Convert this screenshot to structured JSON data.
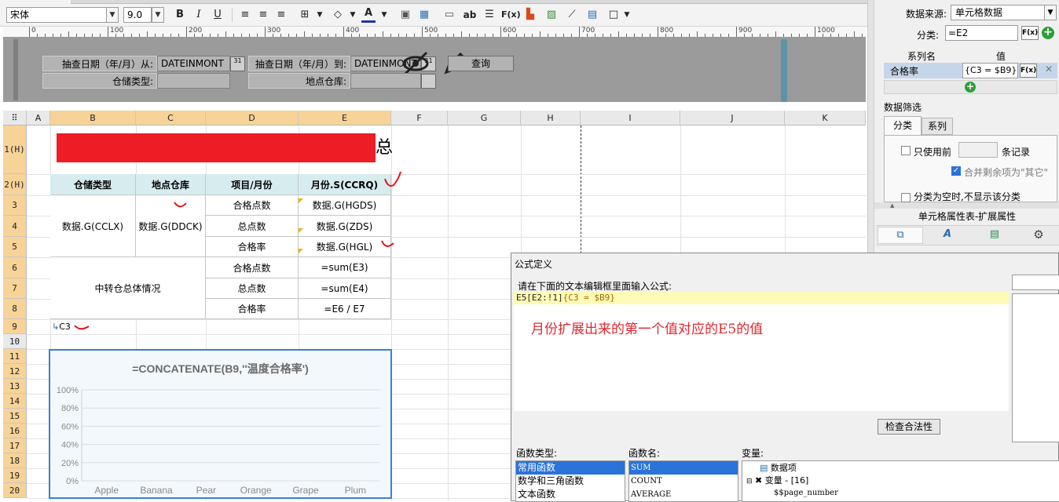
{
  "toolbar": {
    "font_name": "宋体",
    "font_size": "9.0",
    "bold": "B",
    "italic": "I",
    "underline": "U",
    "abc": "ab",
    "formula": "F(x)"
  },
  "ruler": {
    "ticks": [
      "0",
      "100",
      "200",
      "300",
      "400",
      "500",
      "600",
      "700",
      "800",
      "900",
      "1000"
    ]
  },
  "params": {
    "start_label": "抽查日期（年/月）从:",
    "start_value": "DATEINMONT",
    "end_label": "抽查日期（年/月）到:",
    "end_value": "DATEINMONT",
    "query_button": "查询",
    "storage_type_label": "仓储类型:",
    "location_label": "地点仓库:",
    "cal_label": "31"
  },
  "grid": {
    "corner": "⠿",
    "columns": [
      "A",
      "B",
      "C",
      "D",
      "E",
      "F",
      "G",
      "H",
      "I",
      "J",
      "K"
    ],
    "rows": [
      "1(H)",
      "2(H)",
      "3",
      "4",
      "5",
      "6",
      "7",
      "8",
      "9",
      "10",
      "11",
      "12",
      "13",
      "14",
      "15",
      "16",
      "17",
      "18",
      "19",
      "20"
    ],
    "title_tail": "总",
    "headers": {
      "b": "仓储类型",
      "c": "地点仓库",
      "d": "项目/月份",
      "e": "月份.S(CCRQ)"
    },
    "b3": "数据.G(CCLX)",
    "c3": "数据.G(DDCK)",
    "d3": "合格点数",
    "d4": "总点数",
    "d5": "合格率",
    "e3": "数据.G(HGDS)",
    "e4": "数据.G(ZDS)",
    "e5": "数据.G(HGL)",
    "b6": "中转仓总体情况",
    "d6": "合格点数",
    "d7": "总点数",
    "d8": "合格率",
    "e6": "=sum(E3)",
    "e7": "=sum(E4)",
    "e8": "=E6 / E7",
    "b9": "C3"
  },
  "chart_data": {
    "type": "bar",
    "title": "=CONCATENATE(B9,''温度合格率')",
    "categories": [
      "Apple",
      "Banana",
      "Pear",
      "Orange",
      "Grape",
      "Plum"
    ],
    "series": [],
    "yticks": [
      "100%",
      "80%",
      "60%",
      "40%",
      "20%",
      "0%"
    ],
    "ylim": [
      0,
      1
    ],
    "grid": true
  },
  "right_panel": {
    "source_label": "数据来源:",
    "source_value": "单元格数据",
    "category_label": "分类:",
    "category_value": "=E2",
    "series_name_header": "系列名",
    "value_header": "值",
    "series_name": "合格率",
    "series_value": "{C3 = $B9}",
    "filter_title": "数据筛选",
    "tab_category": "分类",
    "tab_series": "系列",
    "only_use_label": "只使用前",
    "records_label": "条记录",
    "merge_label": "合并剩余项为\"其它\"",
    "empty_label": "分类为空时,不显示该分类",
    "props_title": "单元格属性表-扩展属性",
    "fx": "F(x)"
  },
  "dialog": {
    "title": "公式定义",
    "instruction": "请在下面的文本编辑框里面输入公式:",
    "formula_part1": "E5[E2:!1]",
    "formula_part2": "{C3 = $B9}",
    "annotation": "月份扩展出来的第一个值对应的E5的值",
    "check_button": "检查合法性",
    "func_type_label": "函数类型:",
    "func_types": [
      "常用函数",
      "数学和三角函数",
      "文本函数"
    ],
    "func_name_label": "函数名:",
    "func_names": [
      "SUM",
      "COUNT",
      "AVERAGE"
    ],
    "var_label": "变量:",
    "var_items": [
      "数据项",
      "变量 - [16]",
      "$$page_number"
    ]
  }
}
